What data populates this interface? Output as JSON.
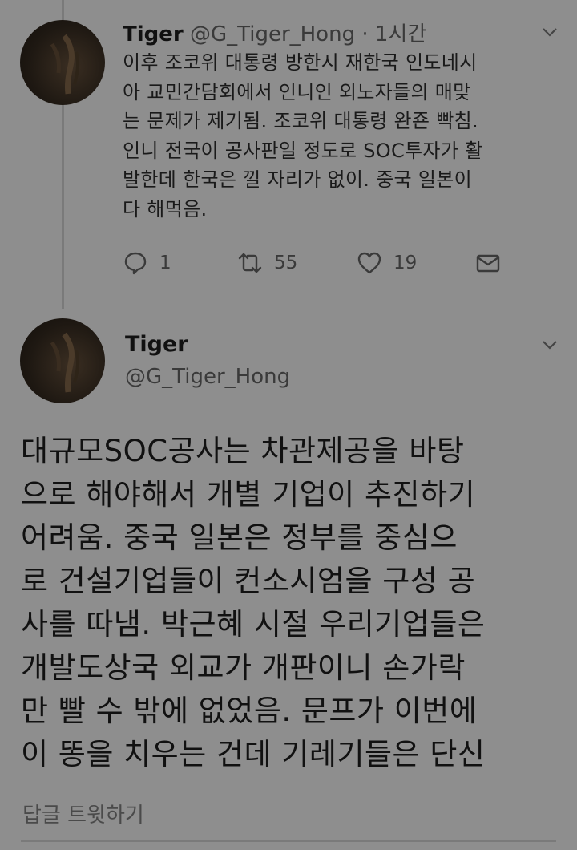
{
  "reply_tweet": {
    "name": "Tiger",
    "handle_time": "@G_Tiger_Hong · 1시간",
    "lines": [
      "이후 조코위 대통령 방한시 재한국 인도네시",
      "아 교민간담회에서 인니인 외노자들의 매맞",
      "는 문제가 제기됨. 조코위 대통령 완죤 빡침.",
      "인니 전국이 공사판일 정도로 SOC투자가 활",
      "발한데 한국은 낄 자리가 없이. 중국 일본이",
      "다 해먹음."
    ],
    "reply_count": "1",
    "retweet_count": "55",
    "like_count": "19"
  },
  "main_tweet": {
    "name": "Tiger",
    "handle": "@G_Tiger_Hong",
    "lines": [
      "대규모SOC공사는 차관제공을 바탕",
      "으로 해야해서 개별 기업이 추진하기",
      "어려움. 중국 일본은 정부를 중심으",
      "로 건설기업들이 컨소시엄을 구성 공",
      "사를 따냄. 박근혜 시절 우리기업들은",
      "개발도상국 외교가 개판이니 손가락",
      "만 빨 수 밖에 없었음. 문프가 이번에",
      "이 똥을 치우는 건데 기레기들은 단신"
    ]
  },
  "reply_box": {
    "placeholder": "답글 트윗하기"
  },
  "icons": {
    "reply": "speech-bubble-icon",
    "retweet": "retweet-icon",
    "like": "heart-icon",
    "dm": "envelope-icon",
    "menu": "chevron-down-icon"
  },
  "colors": {
    "background": "#8e8e8e",
    "text": "#111111",
    "secondary": "#3a3a3a"
  }
}
